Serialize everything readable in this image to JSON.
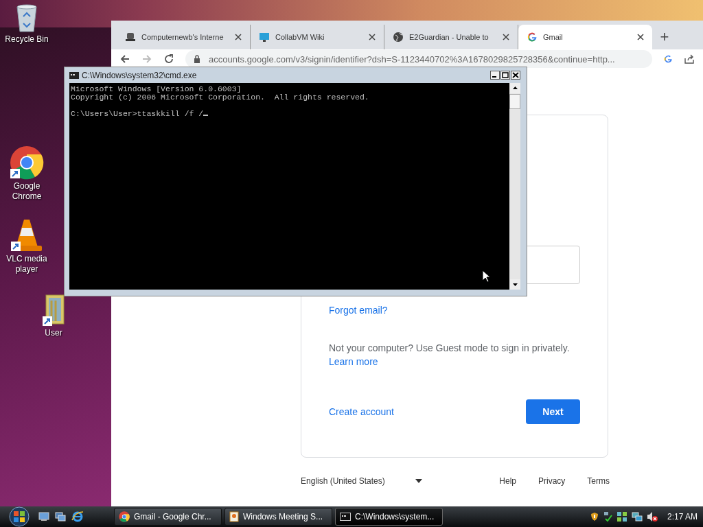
{
  "desktop": {
    "icons": [
      {
        "kind": "bin",
        "label": "Recycle Bin"
      },
      {
        "kind": "chrome",
        "label": "Google Chrome"
      },
      {
        "kind": "vlc",
        "label": "VLC media player"
      },
      {
        "kind": "folder",
        "label": "User"
      }
    ]
  },
  "browser": {
    "tabs": [
      {
        "kind": "server",
        "title": "Computernewb's Interne",
        "selected": false
      },
      {
        "kind": "monitor",
        "title": "CollabVM Wiki",
        "selected": false
      },
      {
        "kind": "globe",
        "title": "E2Guardian - Unable to",
        "selected": false
      },
      {
        "kind": "google",
        "title": "Gmail",
        "selected": true
      }
    ],
    "new_tab": "+",
    "address": "accounts.google.com/v3/signin/identifier?dsh=S-1123440702%3A1678029825728356&continue=http...",
    "page": {
      "forgot_link": "Forgot email?",
      "guest_text": "Not your computer? Use Guest mode to sign in privately.",
      "learn_more": "Learn more",
      "create_account": "Create account",
      "next": "Next",
      "language": "English (United States)",
      "footer_links": [
        "Help",
        "Privacy",
        "Terms"
      ]
    }
  },
  "console": {
    "title": "C:\\Windows\\system32\\cmd.exe",
    "lines": [
      "Microsoft Windows [Version 6.0.6003]",
      "Copyright (c) 2006 Microsoft Corporation.  All rights reserved."
    ],
    "prompt": "C:\\Users\\User>ttaskkill /f /"
  },
  "taskbar": {
    "buttons": [
      {
        "kind": "chrome",
        "label": "Gmail - Google Chr...",
        "selected": false
      },
      {
        "kind": "meeting",
        "label": "Windows Meeting S...",
        "selected": false
      },
      {
        "kind": "cmd",
        "label": "C:\\Windows\\system...",
        "selected": true
      }
    ],
    "clock": "2:17 AM"
  }
}
